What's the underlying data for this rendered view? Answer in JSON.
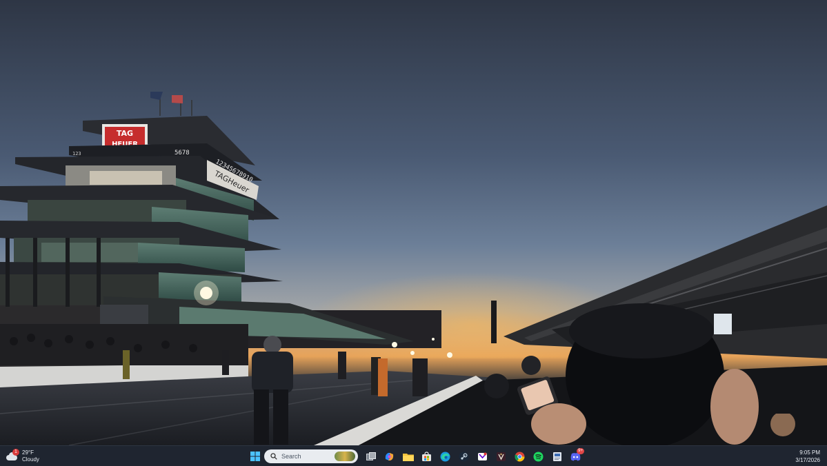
{
  "wallpaper": {
    "pagoda_brand": "TAG HEUER",
    "pagoda_brand_line1": "TAG",
    "pagoda_brand_line2": "HEUER",
    "pagoda_sign": "TAGHeuer",
    "pagoda_numbers": "12345678910",
    "pagoda_numbers_side": "5678",
    "pagoda_numbers_left": "123"
  },
  "taskbar": {
    "weather": {
      "temperature": "29°F",
      "condition": "Cloudy",
      "icon": "cloudy-weather-icon",
      "badge": "1"
    },
    "search": {
      "placeholder": "Search"
    },
    "apps": [
      {
        "name": "start-button",
        "icon": "windows-logo-icon"
      },
      {
        "name": "task-view",
        "icon": "task-view-icon"
      },
      {
        "name": "copilot",
        "icon": "copilot-icon"
      },
      {
        "name": "file-explorer",
        "icon": "folder-icon"
      },
      {
        "name": "microsoft-store",
        "icon": "store-icon"
      },
      {
        "name": "edge",
        "icon": "edge-icon"
      },
      {
        "name": "steam",
        "icon": "steam-icon"
      },
      {
        "name": "yahoo-mail",
        "icon": "yahoo-icon"
      },
      {
        "name": "game-app",
        "icon": "game-icon"
      },
      {
        "name": "chrome",
        "icon": "chrome-icon"
      },
      {
        "name": "spotify",
        "icon": "spotify-icon"
      },
      {
        "name": "document-app",
        "icon": "document-icon"
      },
      {
        "name": "discord",
        "icon": "discord-icon",
        "badge": "9+"
      }
    ],
    "clock": {
      "time": "9:05 PM",
      "date": "3/17/2026"
    }
  }
}
